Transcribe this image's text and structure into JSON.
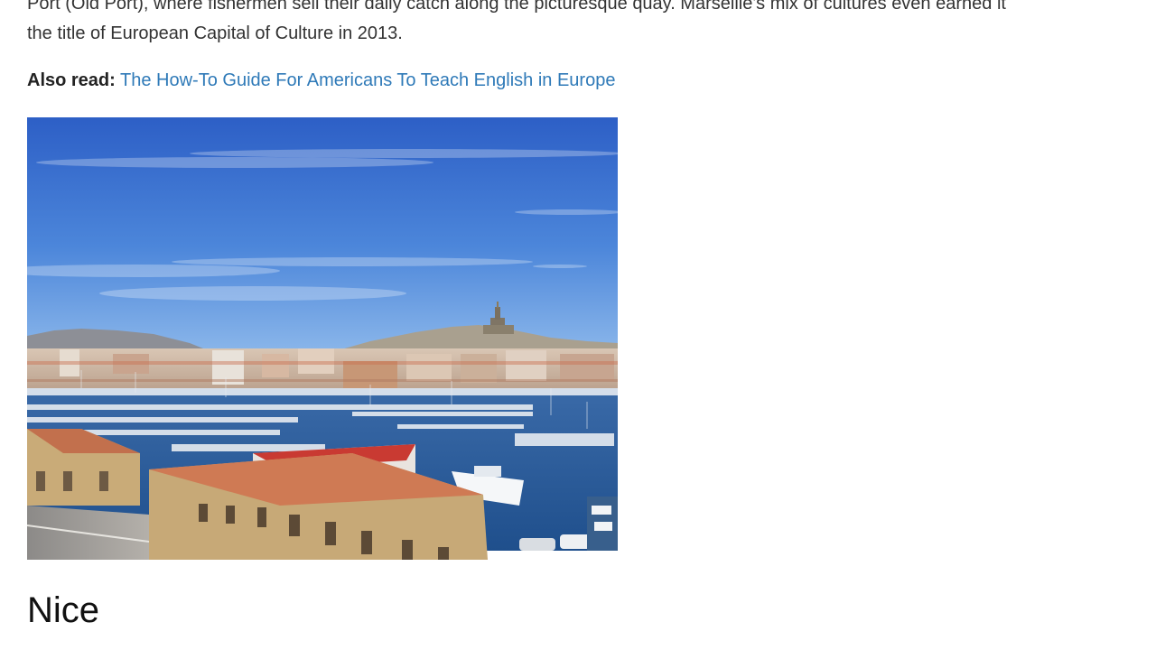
{
  "article": {
    "paragraph_lines": [
      "Port (Old Port), where fishermen sell their daily catch along the picturesque quay. Marseille's mix of cultures even earned it",
      "the title of European Capital of Culture in 2013."
    ],
    "also_read": {
      "label": "Also read:",
      "link_text": "The How-To Guide For Americans To Teach English in Europe"
    },
    "photo": {
      "subject": "Marseille Old Port harbor with boats, city and hilltop basilica",
      "colors": {
        "sky_top": "#2f63c9",
        "sky_bottom": "#7faee6",
        "water": "#2a5d9c",
        "roof": "#c9714a",
        "building": "#c9ab78",
        "hill": "#8d8f96"
      }
    },
    "section_heading": "Nice"
  },
  "theme": {
    "text_color": "#333333",
    "link_color": "#2f7ab8",
    "heading_color": "#111111"
  }
}
